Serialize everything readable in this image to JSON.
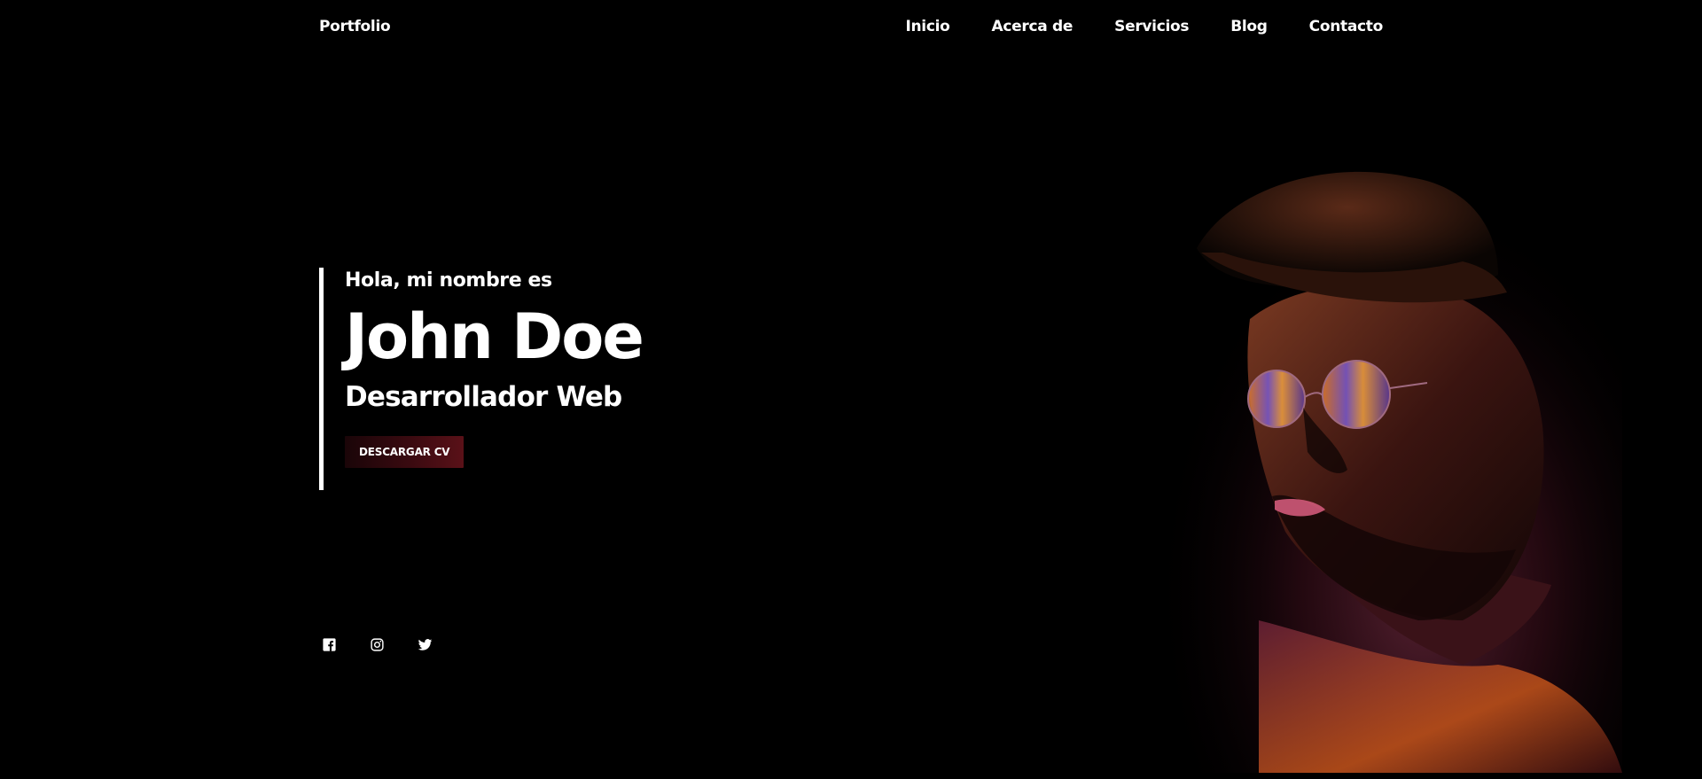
{
  "header": {
    "brand": "Portfolio",
    "nav": [
      "Inicio",
      "Acerca de",
      "Servicios",
      "Blog",
      "Contacto"
    ]
  },
  "hero": {
    "greeting": "Hola, mi nombre es",
    "name": "John Doe",
    "role": "Desarrollador Web",
    "cta_label": "DESCARGAR CV"
  },
  "social": {
    "icons": [
      "facebook-icon",
      "instagram-icon",
      "twitter-icon"
    ]
  },
  "colors": {
    "background": "#000000",
    "text": "#ffffff",
    "accent": "#5a1118",
    "portrait_glow_warm": "#c2531a",
    "portrait_glow_pink": "#c23a6a"
  }
}
